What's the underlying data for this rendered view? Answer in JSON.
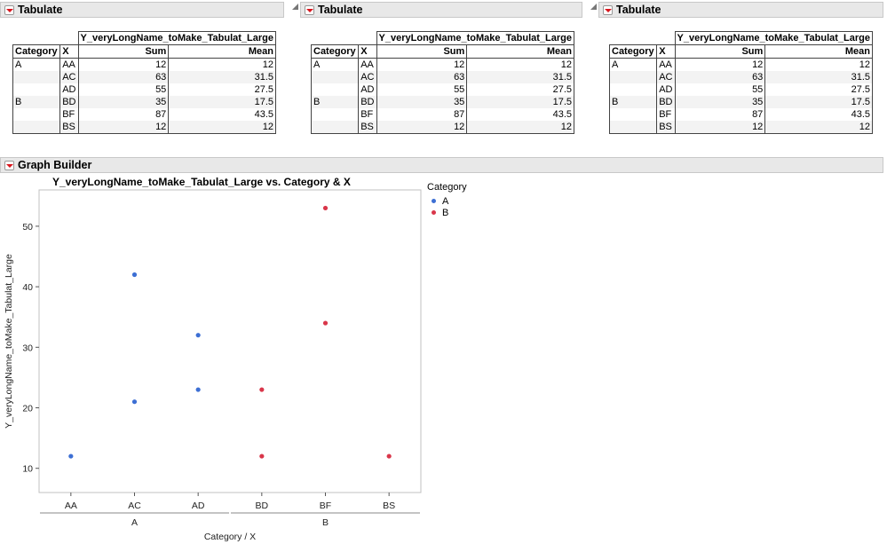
{
  "panels": [
    {
      "title": "Tabulate"
    },
    {
      "title": "Tabulate"
    },
    {
      "title": "Tabulate"
    }
  ],
  "table": {
    "measure_header": "Y_veryLongName_toMake_Tabulat_Large",
    "col_headers": [
      "Category",
      "X",
      "Sum",
      "Mean"
    ],
    "rows": [
      {
        "category": "A",
        "x": "AA",
        "sum": "12",
        "mean": "12"
      },
      {
        "category": "",
        "x": "AC",
        "sum": "63",
        "mean": "31.5"
      },
      {
        "category": "",
        "x": "AD",
        "sum": "55",
        "mean": "27.5"
      },
      {
        "category": "B",
        "x": "BD",
        "sum": "35",
        "mean": "17.5"
      },
      {
        "category": "",
        "x": "BF",
        "sum": "87",
        "mean": "43.5"
      },
      {
        "category": "",
        "x": "BS",
        "sum": "12",
        "mean": "12"
      }
    ]
  },
  "graph_builder": {
    "panel_title": "Graph Builder",
    "legend_title": "Category",
    "legend_items": [
      {
        "label": "A",
        "color": "#3d6fd4"
      },
      {
        "label": "B",
        "color": "#d9364a"
      }
    ]
  },
  "chart_data": {
    "type": "scatter",
    "title": "Y_veryLongName_toMake_Tabulat_Large vs. Category & X",
    "xlabel": "Category / X",
    "ylabel": "Y_veryLongName_toMake_Tabulat_Large",
    "x_categories": [
      "AA",
      "AC",
      "AD",
      "BD",
      "BF",
      "BS"
    ],
    "x_groups": [
      {
        "label": "A",
        "categories": [
          "AA",
          "AC",
          "AD"
        ]
      },
      {
        "label": "B",
        "categories": [
          "BD",
          "BF",
          "BS"
        ]
      }
    ],
    "ylim": [
      6,
      56
    ],
    "yticks": [
      10,
      20,
      30,
      40,
      50
    ],
    "grid": false,
    "legend_position": "right",
    "series": [
      {
        "name": "A",
        "color": "#3d6fd4",
        "points": [
          {
            "x": "AA",
            "y": 12
          },
          {
            "x": "AC",
            "y": 42
          },
          {
            "x": "AC",
            "y": 21
          },
          {
            "x": "AD",
            "y": 32
          },
          {
            "x": "AD",
            "y": 23
          }
        ]
      },
      {
        "name": "B",
        "color": "#d9364a",
        "points": [
          {
            "x": "BD",
            "y": 23
          },
          {
            "x": "BD",
            "y": 12
          },
          {
            "x": "BF",
            "y": 53
          },
          {
            "x": "BF",
            "y": 34
          },
          {
            "x": "BS",
            "y": 12
          }
        ]
      }
    ]
  }
}
